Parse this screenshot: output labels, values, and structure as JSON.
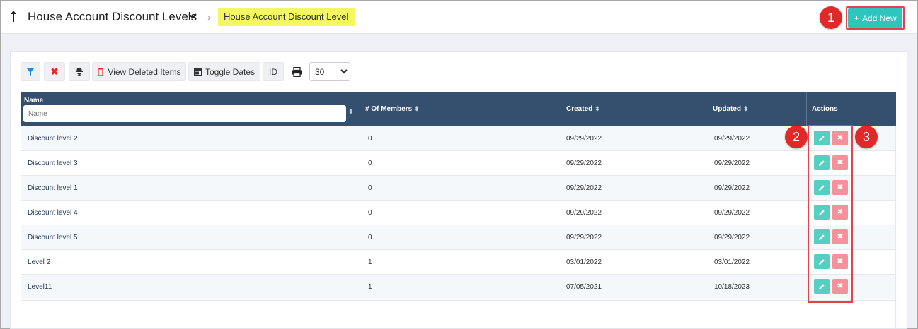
{
  "header": {
    "title": "House Account Discount Levels",
    "breadcrumb": "House Account Discount Level",
    "add_new_label": "Add New"
  },
  "badges": [
    "1",
    "2",
    "3"
  ],
  "toolbar": {
    "view_deleted_label": "View Deleted Items",
    "toggle_dates_label": "Toggle Dates",
    "id_label": "ID",
    "page_size": "30"
  },
  "table": {
    "columns": [
      "Name",
      "# Of Members",
      "Created",
      "Updated",
      "Actions"
    ],
    "name_placeholder": "Name",
    "rows": [
      {
        "name": "Discount level 2",
        "members": "0",
        "created": "09/29/2022",
        "updated": "09/29/2022"
      },
      {
        "name": "Discount level 3",
        "members": "0",
        "created": "09/29/2022",
        "updated": "09/29/2022"
      },
      {
        "name": "Discount level 1",
        "members": "0",
        "created": "09/29/2022",
        "updated": "09/29/2022"
      },
      {
        "name": "Discount level 4",
        "members": "0",
        "created": "09/29/2022",
        "updated": "09/29/2022"
      },
      {
        "name": "Discount level 5",
        "members": "0",
        "created": "09/29/2022",
        "updated": "09/29/2022"
      },
      {
        "name": "Level 2",
        "members": "1",
        "created": "03/01/2022",
        "updated": "03/01/2022"
      },
      {
        "name": "Level11",
        "members": "1",
        "created": "07/05/2021",
        "updated": "10/18/2023"
      }
    ]
  },
  "colors": {
    "accent": "#2ec5bf",
    "header_bg": "#34506e",
    "edit": "#56cec2",
    "delete": "#f4919b",
    "highlight": "#f3f862",
    "callout": "#e0434c"
  },
  "icons": [
    "up-arrow-icon",
    "chevron-down-icon",
    "chevron-right-icon",
    "plus-icon",
    "filter-icon",
    "clear-icon",
    "user-secret-icon",
    "trash-icon",
    "calendar-icon",
    "print-icon",
    "sort-icon",
    "pencil-icon",
    "close-icon"
  ]
}
